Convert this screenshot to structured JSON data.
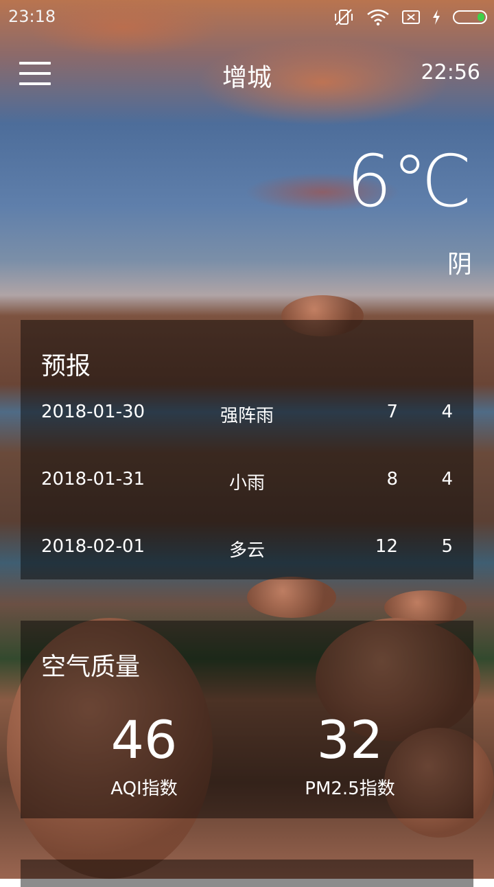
{
  "status_bar": {
    "time": "23:18",
    "icons": [
      "vibrate-icon",
      "wifi-icon",
      "sim-icon",
      "charging-icon",
      "battery-icon"
    ],
    "battery_color": "#3fd04a"
  },
  "header": {
    "menu_icon": "hamburger-menu-icon",
    "city": "增城",
    "update_time": "22:56"
  },
  "now": {
    "temperature": "6℃",
    "condition": "阴"
  },
  "forecast": {
    "title": "预报",
    "rows": [
      {
        "date": "2018-01-30",
        "weather": "强阵雨",
        "max": "7",
        "min": "4"
      },
      {
        "date": "2018-01-31",
        "weather": "小雨",
        "max": "8",
        "min": "4"
      },
      {
        "date": "2018-02-01",
        "weather": "多云",
        "max": "12",
        "min": "5"
      }
    ]
  },
  "aqi": {
    "title": "空气质量",
    "aqi_value": "46",
    "aqi_label": "AQI指数",
    "pm25_value": "32",
    "pm25_label": "PM2.5指数"
  }
}
